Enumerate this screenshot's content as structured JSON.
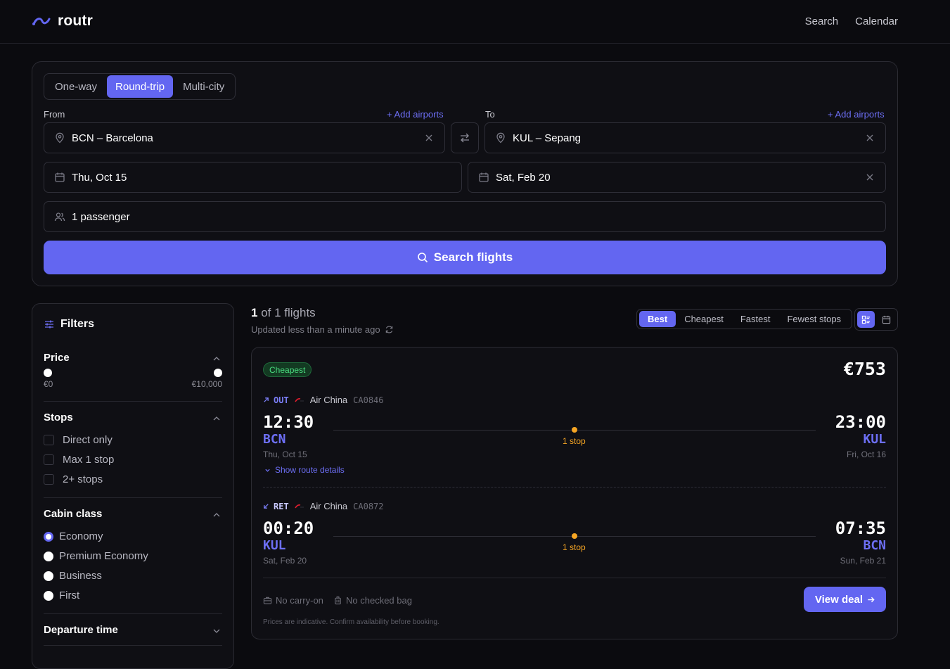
{
  "header": {
    "logo_text": "routr",
    "nav": [
      "Search",
      "Calendar"
    ]
  },
  "search": {
    "trip_types": [
      "One-way",
      "Round-trip",
      "Multi-city"
    ],
    "active_trip_type": "Round-trip",
    "from_label": "From",
    "to_label": "To",
    "add_airports": "+ Add airports",
    "from_value": "BCN – Barcelona",
    "to_value": "KUL – Sepang",
    "depart_date": "Thu, Oct 15",
    "return_date": "Sat, Feb 20",
    "passengers": "1 passenger",
    "search_button": "Search flights"
  },
  "filters": {
    "title": "Filters",
    "price": {
      "title": "Price",
      "min_label": "€0",
      "max_label": "€10,000"
    },
    "stops": {
      "title": "Stops",
      "options": [
        "Direct only",
        "Max 1 stop",
        "2+ stops"
      ]
    },
    "cabin": {
      "title": "Cabin class",
      "options": [
        "Economy",
        "Premium Economy",
        "Business",
        "First"
      ],
      "selected": "Economy"
    },
    "departure": {
      "title": "Departure time"
    }
  },
  "results": {
    "count_bold": "1",
    "count_rest": " of 1 flights",
    "updated": "Updated less than a minute ago",
    "sort_options": [
      "Best",
      "Cheapest",
      "Fastest",
      "Fewest stops"
    ],
    "active_sort": "Best"
  },
  "card": {
    "badge": "Cheapest",
    "price": "€753",
    "out": {
      "dir": "OUT",
      "airline": "Air China",
      "flight": "CA0846",
      "dep_time": "12:30",
      "dep_code": "BCN",
      "dep_date": "Thu, Oct 15",
      "arr_time": "23:00",
      "arr_code": "KUL",
      "arr_date": "Fri, Oct 16",
      "stops": "1 stop"
    },
    "ret": {
      "dir": "RET",
      "airline": "Air China",
      "flight": "CA0872",
      "dep_time": "00:20",
      "dep_code": "KUL",
      "dep_date": "Sat, Feb 20",
      "arr_time": "07:35",
      "arr_code": "BCN",
      "arr_date": "Sun, Feb 21",
      "stops": "1 stop"
    },
    "show_details": "Show route details",
    "carry_on": "No carry-on",
    "checked_bag": "No checked bag",
    "view_deal": "View deal",
    "disclaimer": "Prices are indicative. Confirm availability before booking."
  },
  "colors": {
    "accent": "#6366f1",
    "stop": "#f5a524",
    "badge_text": "#4ade80"
  }
}
